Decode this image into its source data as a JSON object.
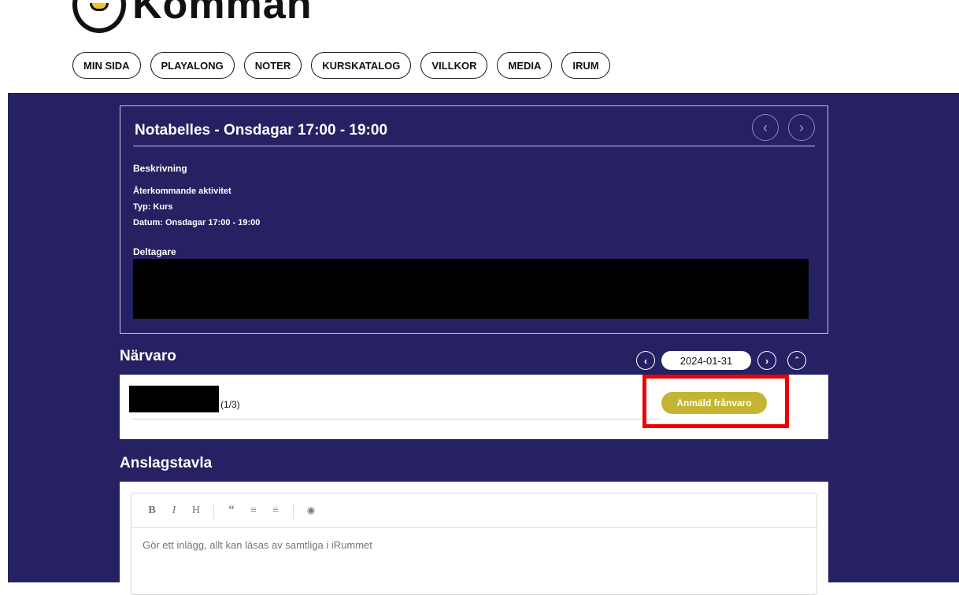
{
  "header": {
    "logo_text": "Komman"
  },
  "nav": [
    {
      "label": "MIN SIDA"
    },
    {
      "label": "PLAYALONG"
    },
    {
      "label": "NOTER"
    },
    {
      "label": "KURSKATALOG"
    },
    {
      "label": "VILLKOR"
    },
    {
      "label": "MEDIA"
    },
    {
      "label": "IRUM"
    }
  ],
  "event": {
    "title": "Notabelles - Onsdagar 17:00 - 19:00",
    "description_label": "Beskrivning",
    "recurring": "Återkommande aktivitet",
    "type": "Typ: Kurs",
    "date": "Datum: Onsdagar 17:00 - 19:00",
    "participants_label": "Deltagare"
  },
  "attendance": {
    "title": "Närvaro",
    "date": "2024-01-31",
    "count": "(1/3)",
    "absence_button": "Anmäld frånvaro"
  },
  "board": {
    "title": "Anslagstavla",
    "placeholder": "Gör ett inlägg, allt kan läsas av samtliga i iRummet"
  },
  "colors": {
    "main_bg": "#262162",
    "absence_button": "#c3b531",
    "highlight": "#ee0000"
  }
}
